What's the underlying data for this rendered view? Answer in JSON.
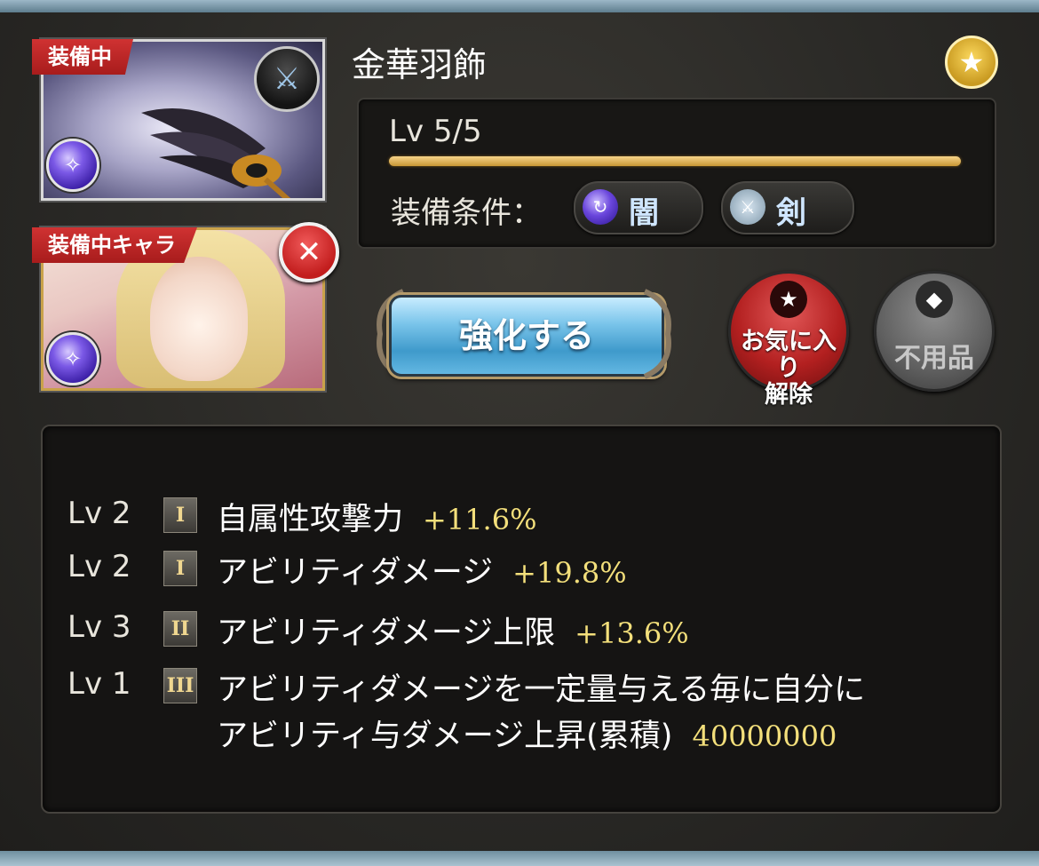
{
  "weapon": {
    "equipped_label": "装備中",
    "name": "金華羽飾",
    "level": "Lv 5/5",
    "level_progress": 1.0,
    "condition_label": "装備条件：",
    "conditions": [
      {
        "icon": "dark-element-icon",
        "label": "闇"
      },
      {
        "icon": "sword-type-icon",
        "label": "剣"
      }
    ]
  },
  "character": {
    "equipped_label": "装備中キャラ"
  },
  "buttons": {
    "enhance": "強化する",
    "favorite_remove": "お気に入り\n解除",
    "favorite_line1": "お気に入り",
    "favorite_line2": "解除",
    "junk": "不用品"
  },
  "skills": [
    {
      "level": "Lv 2",
      "rank": "I",
      "name": "自属性攻撃力",
      "value": "+11.6%"
    },
    {
      "level": "Lv 2",
      "rank": "I",
      "name": "アビリティダメージ",
      "value": "+19.8%"
    },
    {
      "level": "Lv 3",
      "rank": "II",
      "name": "アビリティダメージ上限",
      "value": "+13.6%"
    },
    {
      "level": "Lv 1",
      "rank": "III",
      "name": "アビリティダメージを一定量与える毎に自分に",
      "name_line2": "アビリティ与ダメージ上昇(累積)",
      "value": "40000000"
    }
  ],
  "colors": {
    "accent_gold": "#f3df7b",
    "ribbon_red": "#c02828",
    "enhance_blue": "#63b7e2"
  }
}
